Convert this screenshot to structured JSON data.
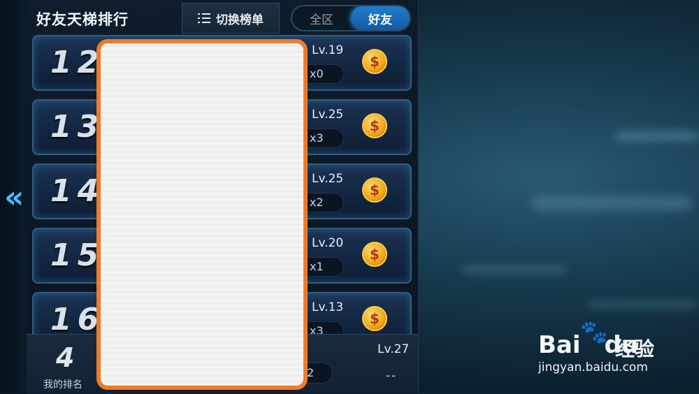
{
  "header": {
    "title": "好友天梯排行",
    "switch_label": "切换榜单",
    "tabs": [
      {
        "label": "全区",
        "active": false
      },
      {
        "label": "好友",
        "active": true
      }
    ]
  },
  "rows": [
    {
      "rank": "12",
      "level": "Lv.19",
      "count": "x0"
    },
    {
      "rank": "13",
      "level": "Lv.25",
      "count": "x3"
    },
    {
      "rank": "14",
      "level": "Lv.25",
      "count": "x2"
    },
    {
      "rank": "15",
      "level": "Lv.20",
      "count": "x1"
    },
    {
      "rank": "16",
      "level": "Lv.13",
      "count": "x3"
    }
  ],
  "my": {
    "rank": "4",
    "label": "我的排名",
    "level": "Lv.27",
    "count": "2",
    "extra": "--"
  },
  "watermark": {
    "logo": "Bai",
    "logo2": "du",
    "brand": "经验",
    "url": "jingyan.baidu.com"
  },
  "colors": {
    "accent": "#1f7fd0",
    "redaction_border": "#f07a28",
    "coin": "#f0a418"
  },
  "icons": {
    "back": "chevron-left-icon",
    "list": "list-icon",
    "coin": "gold-badge-icon"
  }
}
